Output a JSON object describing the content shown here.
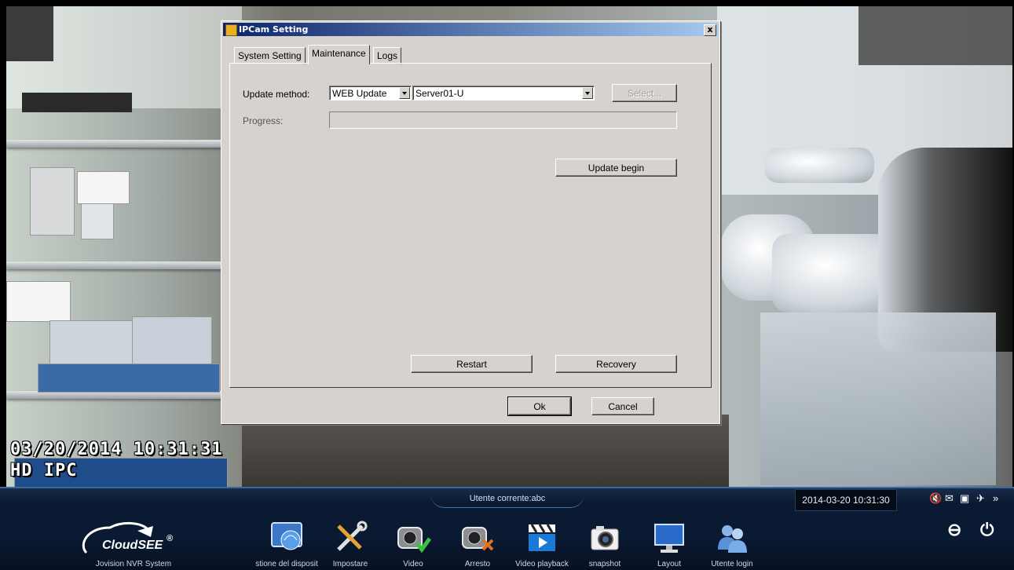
{
  "osd": {
    "datetime": "03/20/2014 10:31:31",
    "label": "HD IPC"
  },
  "dialog": {
    "title": "IPCam Setting",
    "close_symbol": "x",
    "tabs": [
      {
        "label": "System Setting",
        "active": false
      },
      {
        "label": "Maintenance",
        "active": true
      },
      {
        "label": "Logs",
        "active": false
      }
    ],
    "update_method_label": "Update method:",
    "update_method_value": "WEB Update",
    "server_value": "Server01-U",
    "select_button": "Select...",
    "progress_label": "Progress:",
    "progress_value": 0,
    "update_begin_button": "Update begin",
    "restart_button": "Restart",
    "recovery_button": "Recovery",
    "ok_button": "Ok",
    "cancel_button": "Cancel"
  },
  "taskbar": {
    "current_user": "Utente corrente:abc",
    "clock": "2014-03-20 10:31:30",
    "tray_icons": [
      "mute-icon",
      "mail-icon",
      "monitor-icon",
      "pin-icon",
      "chevron-down-icon"
    ],
    "brand_caption": "Jovision NVR System",
    "logo_text": "CloudSEE",
    "logo_mark": "®",
    "items": [
      {
        "label": "stione del disposit",
        "icon": "device-management-icon"
      },
      {
        "label": "Impostare",
        "icon": "settings-tools-icon"
      },
      {
        "label": "Video",
        "icon": "video-start-icon"
      },
      {
        "label": "Arresto",
        "icon": "video-stop-icon"
      },
      {
        "label": "Video playback",
        "icon": "playback-icon"
      },
      {
        "label": "snapshot",
        "icon": "snapshot-icon"
      },
      {
        "label": "Layout",
        "icon": "layout-icon"
      },
      {
        "label": "Utente login",
        "icon": "user-login-icon"
      }
    ],
    "minimize_symbol": "⊖",
    "power_symbol": "⏻"
  }
}
